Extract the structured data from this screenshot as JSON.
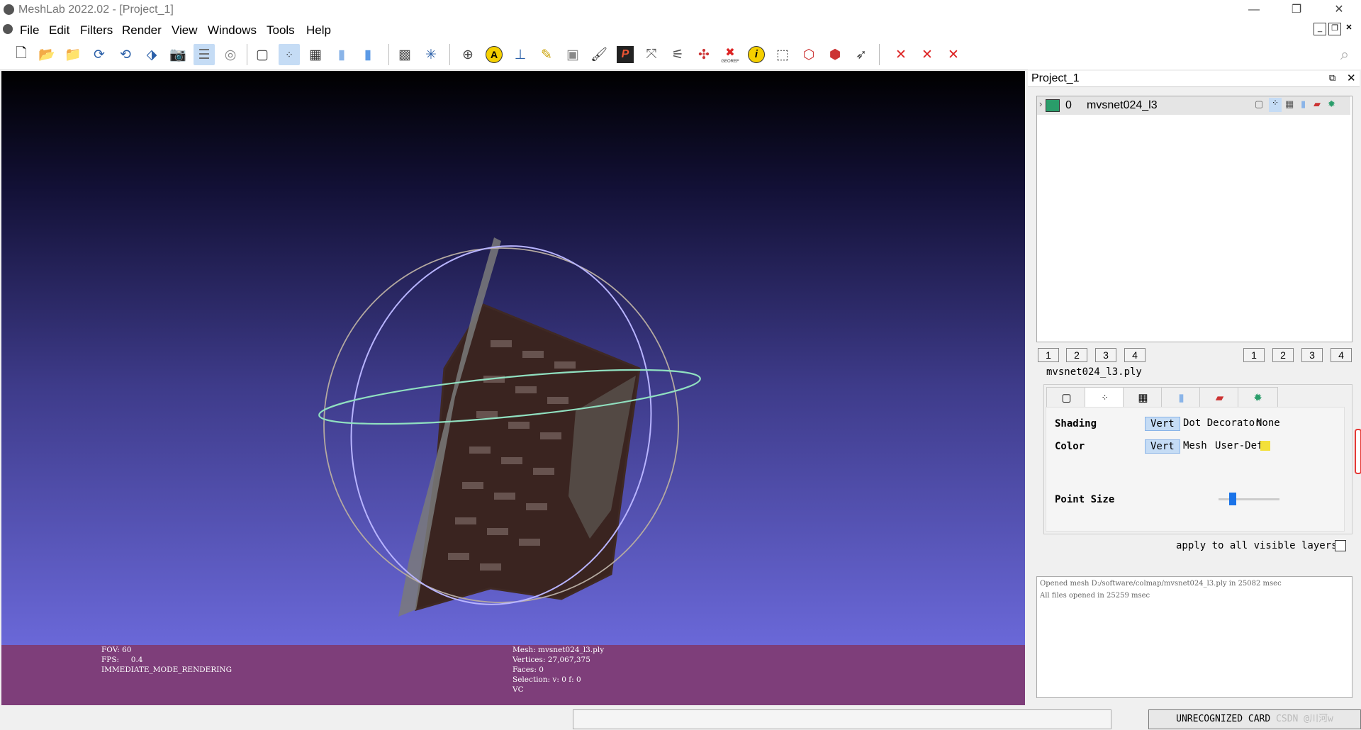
{
  "window": {
    "title": "MeshLab 2022.02 - [Project_1]"
  },
  "menu": [
    "File",
    "Edit",
    "Filters",
    "Render",
    "View",
    "Windows",
    "Tools",
    "Help"
  ],
  "toolbar": {
    "icons": [
      "new-project-icon",
      "import-mesh-icon",
      "open-project-icon",
      "reload-icon",
      "reload-all-icon",
      "export-mesh-icon",
      "snapshot-icon",
      "layers-icon",
      "raster-icon",
      "bbox-icon",
      "points-icon",
      "wireframe-icon",
      "flat-icon",
      "smooth-icon",
      "texture-icon",
      "axes-icon",
      "trackball-icon",
      "label-a-icon",
      "measure-icon",
      "pick-icon",
      "camera-icon",
      "paint-icon",
      "pp-icon",
      "align-icon",
      "select-vertex-icon",
      "manipulator-icon",
      "georef-icon",
      "info-icon",
      "select-rect-icon",
      "select-face-icon",
      "select-connected-icon",
      "pointer-icon",
      "delete-vertices-icon",
      "delete-faces-icon",
      "delete-all-icon"
    ],
    "georef_label": "GEOREF"
  },
  "viewport_info": {
    "left": "FOV: 60\nFPS:     0.4\nIMMEDIATE_MODE_RENDERING",
    "right": "Mesh: mvsnet024_l3.ply\nVertices: 27,067,375\nFaces: 0\nSelection: v: 0 f: 0\nVC"
  },
  "project_panel": {
    "title": "Project_1",
    "layer": {
      "index": "0",
      "name": "mvsnet024_l3"
    },
    "buttons_left": [
      "1",
      "2",
      "3",
      "4"
    ],
    "buttons_right": [
      "1",
      "2",
      "3",
      "4"
    ]
  },
  "decorator": {
    "group_title": "mvsnet024_l3.ply",
    "shading_label": "Shading",
    "shading_options": [
      "Vert",
      "Dot Decorator",
      "None"
    ],
    "shading_selected": "Vert",
    "color_label": "Color",
    "color_options": [
      "Vert",
      "Mesh",
      "User-Def"
    ],
    "color_selected": "Vert",
    "user_def_color": "#f3e03a",
    "point_size_label": "Point Size",
    "point_size_value": 0.23,
    "apply_all_label": "apply to all visible layers"
  },
  "log": [
    "Opened mesh D:/software/colmap/mvsnet024_l3.ply in 25082 msec",
    "All files opened in 25259 msec"
  ],
  "status": {
    "card": "UNRECOGNIZED CARD",
    "watermark": "CSDN @川河w"
  }
}
